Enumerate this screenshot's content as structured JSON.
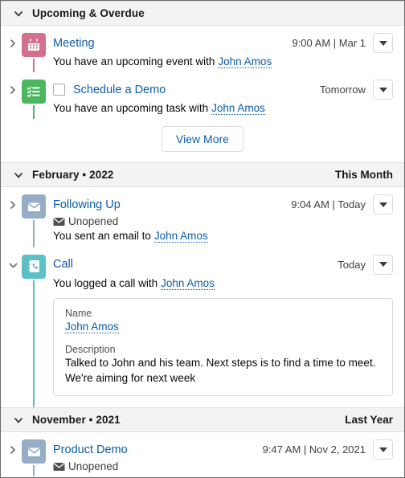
{
  "sections": [
    {
      "id": "upcoming",
      "title": "Upcoming & Overdue",
      "right_label": "",
      "expanded": true
    },
    {
      "id": "february",
      "title": "February • 2022",
      "right_label": "This Month",
      "expanded": true
    },
    {
      "id": "november",
      "title": "November • 2021",
      "right_label": "Last Year",
      "expanded": true
    }
  ],
  "items": {
    "meeting": {
      "title": "Meeting",
      "timestamp": "9:00 AM | Mar 1",
      "description_prefix": "You have an upcoming event with",
      "person": "John Amos",
      "icon": "calendar-icon",
      "icon_color": "#D4708E",
      "line_color": "#D4708E",
      "expanded": false
    },
    "task": {
      "title": "Schedule a Demo",
      "timestamp": "Tomorrow",
      "description_prefix": "You have an upcoming task with",
      "person": "John Amos",
      "icon": "task-checklist-icon",
      "icon_color": "#4BB75E",
      "line_color": "#4BB75E",
      "expanded": false,
      "checkbox_checked": false
    },
    "email_following_up": {
      "title": "Following Up",
      "timestamp": "9:04 AM | Today",
      "status": "Unopened",
      "description_prefix": "You sent an email to",
      "person": "John Amos",
      "icon": "email-icon",
      "icon_color": "#95AEC6",
      "line_color": "#95AEC6",
      "expanded": false
    },
    "call": {
      "title": "Call",
      "timestamp": "Today",
      "description_prefix": "You logged a call with",
      "person": "John Amos",
      "icon": "call-log-icon",
      "icon_color": "#5BC0C8",
      "line_color": "#5BC0C8",
      "expanded": true,
      "detail": {
        "name_label": "Name",
        "name_value": "John Amos",
        "description_label": "Description",
        "description_value": "Talked to John and his team. Next steps is to find a time to meet. We're aiming for next week"
      }
    },
    "email_product_demo": {
      "title": "Product Demo",
      "timestamp": "9:47 AM | Nov 2, 2021",
      "status": "Unopened",
      "icon": "email-icon",
      "icon_color": "#95AEC6",
      "line_color": "#95AEC6",
      "expanded": false
    }
  },
  "buttons": {
    "view_more": "View More"
  },
  "colors": {
    "link": "#0b5cab",
    "header_bg": "#f3f3f3",
    "text": "#080707",
    "muted": "#3e3e3c",
    "border": "#dddbda"
  }
}
